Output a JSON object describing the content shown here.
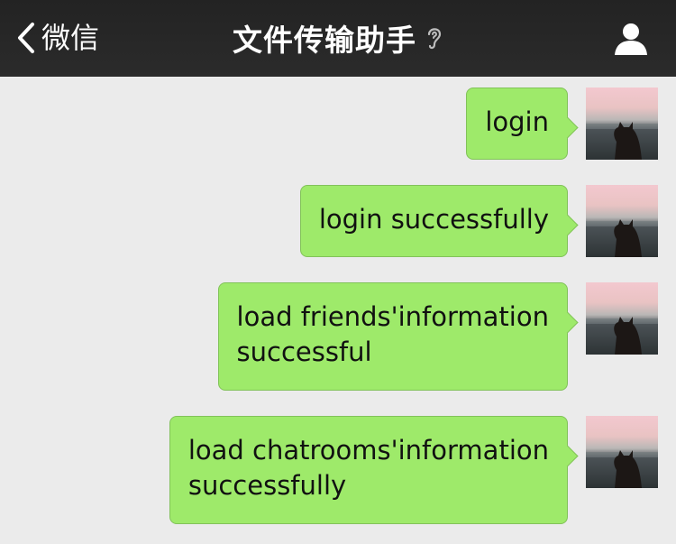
{
  "header": {
    "back_label": "微信",
    "title": "文件传输助手",
    "ear_icon": "ear-icon",
    "profile_icon": "user-icon"
  },
  "messages": [
    {
      "text": "login"
    },
    {
      "text": "login successfully"
    },
    {
      "text": "load friends'information\nsuccessful"
    },
    {
      "text": "load chatrooms'information\nsuccessfully"
    }
  ],
  "colors": {
    "navbar": "#262626",
    "background": "#ebebeb",
    "bubble": "#9eea6a"
  }
}
